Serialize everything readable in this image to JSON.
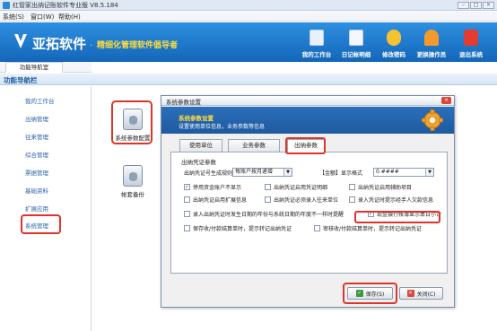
{
  "window": {
    "title": "红管家出纳记账软件专业版 V8.5.184",
    "min": "–",
    "max": "□",
    "close": "×"
  },
  "menu": [
    "系统(S)",
    "窗口(W)",
    "帮助(H)"
  ],
  "banner": {
    "brand": "亚拓软件",
    "dot": "·",
    "slogan": "精细化管理软件倡导者",
    "toolbar": [
      {
        "label": "我的工作台",
        "icon": "monitor-icon"
      },
      {
        "label": "日记帐明细",
        "icon": "ledger-icon"
      },
      {
        "label": "修改密码",
        "icon": "key-lock-icon"
      },
      {
        "label": "更换操作员",
        "icon": "user-icon"
      },
      {
        "label": "退出系统",
        "icon": "power-icon"
      }
    ]
  },
  "nav": {
    "tab_label": "功能导航室",
    "header": "功能导航栏",
    "items": [
      "我的工作台",
      "出纳管理",
      "往来管理",
      "综合管理",
      "票据管理",
      "基础资料",
      "扩展应用",
      "系统管理"
    ],
    "active_index": 7
  },
  "main": {
    "icons": [
      {
        "label": "系统参数配置",
        "icon": "system-params-icon"
      },
      {
        "label": "帐套备份",
        "icon": "backup-icon"
      }
    ]
  },
  "dialog": {
    "title": "系统参数设置",
    "close": "×",
    "header_title": "系统参数设置",
    "header_sub": "设置使用单位信息，业务参数等信息",
    "tabs": [
      "使用单位",
      "业务参数",
      "出纳参数"
    ],
    "active_tab": 2,
    "section": "出纳凭证参数",
    "rule_label": "出纳凭证号生成规则",
    "rule_value": "每账户按月递增",
    "format_label": "【金额】显示格式",
    "format_value": "0.####",
    "checkboxes": [
      {
        "label": "停用资金账户不显示",
        "checked": true
      },
      {
        "label": "出纳凭证启用凭证明细",
        "checked": false
      },
      {
        "label": "出纳凭证启用辅助项目",
        "checked": false
      },
      {
        "label": "出纳凭证启用扩展信息",
        "checked": false
      },
      {
        "label": "出纳凭证必须录入往来单位",
        "checked": false
      },
      {
        "label": "录入凭证时提示经手人欠款信息",
        "checked": false
      },
      {
        "label": "录入出纳凭证时发生日期的年份与系统日期的年度不一样时提醒",
        "checked": false
      },
      {
        "label": "现金银行帐簿显示本日小计",
        "checked": true
      },
      {
        "label": "保存收/付款结算单时，提示转记出纳凭证",
        "checked": false
      },
      {
        "label": "审核收/付款结算单时，提示转记出纳凭证",
        "checked": false
      }
    ],
    "check_mark": "✓",
    "save_label": "保存(S)",
    "cancel_label": "关闭(C)"
  },
  "colors": {
    "banner": "#1a73c9",
    "highlight": "#e0332a",
    "slogan": "#ffde3b",
    "nav_link": "#2a63a8"
  }
}
